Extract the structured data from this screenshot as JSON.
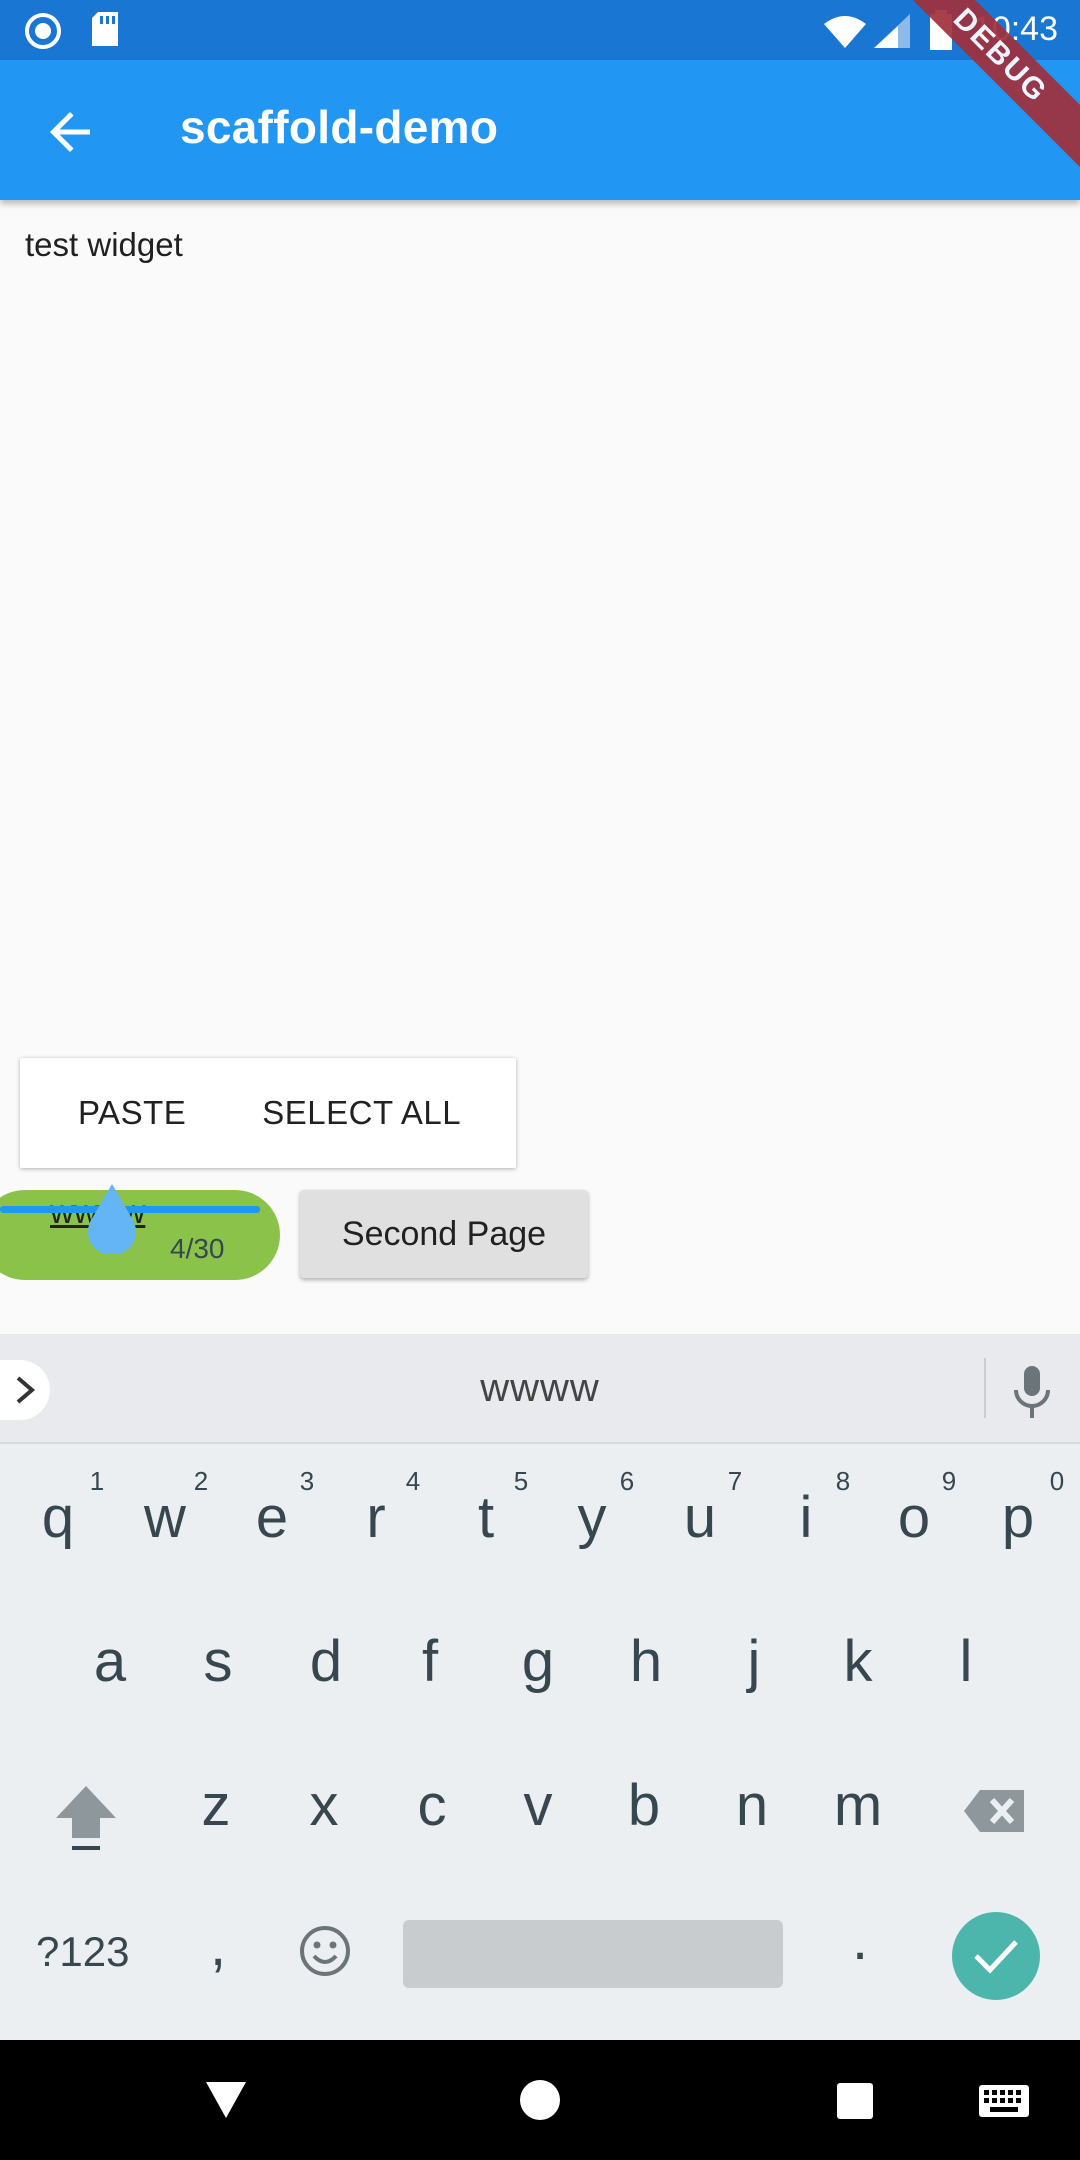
{
  "status_bar": {
    "time": "10:43"
  },
  "app_bar": {
    "title": "scaffold-demo",
    "debug_label": "DEBUG"
  },
  "content": {
    "text": "test widget"
  },
  "context_menu": {
    "paste": "PASTE",
    "select_all": "SELECT ALL"
  },
  "text_field": {
    "value": "wwww",
    "counter": "4/30"
  },
  "second_page_button": {
    "label": "Second Page"
  },
  "keyboard": {
    "suggestion": "wwww",
    "row1": [
      "q",
      "w",
      "e",
      "r",
      "t",
      "y",
      "u",
      "i",
      "o",
      "p"
    ],
    "row1_hints": [
      "1",
      "2",
      "3",
      "4",
      "5",
      "6",
      "7",
      "8",
      "9",
      "0"
    ],
    "row2": [
      "a",
      "s",
      "d",
      "f",
      "g",
      "h",
      "j",
      "k",
      "l"
    ],
    "row3": [
      "z",
      "x",
      "c",
      "v",
      "b",
      "n",
      "m"
    ],
    "symbols_key": "?123",
    "comma_key": ",",
    "period_key": "."
  },
  "colors": {
    "app_bar": "#2196f3",
    "status_bar": "#1976d2",
    "field_bg": "#8bc34a",
    "enter_key": "#4db6ac"
  }
}
